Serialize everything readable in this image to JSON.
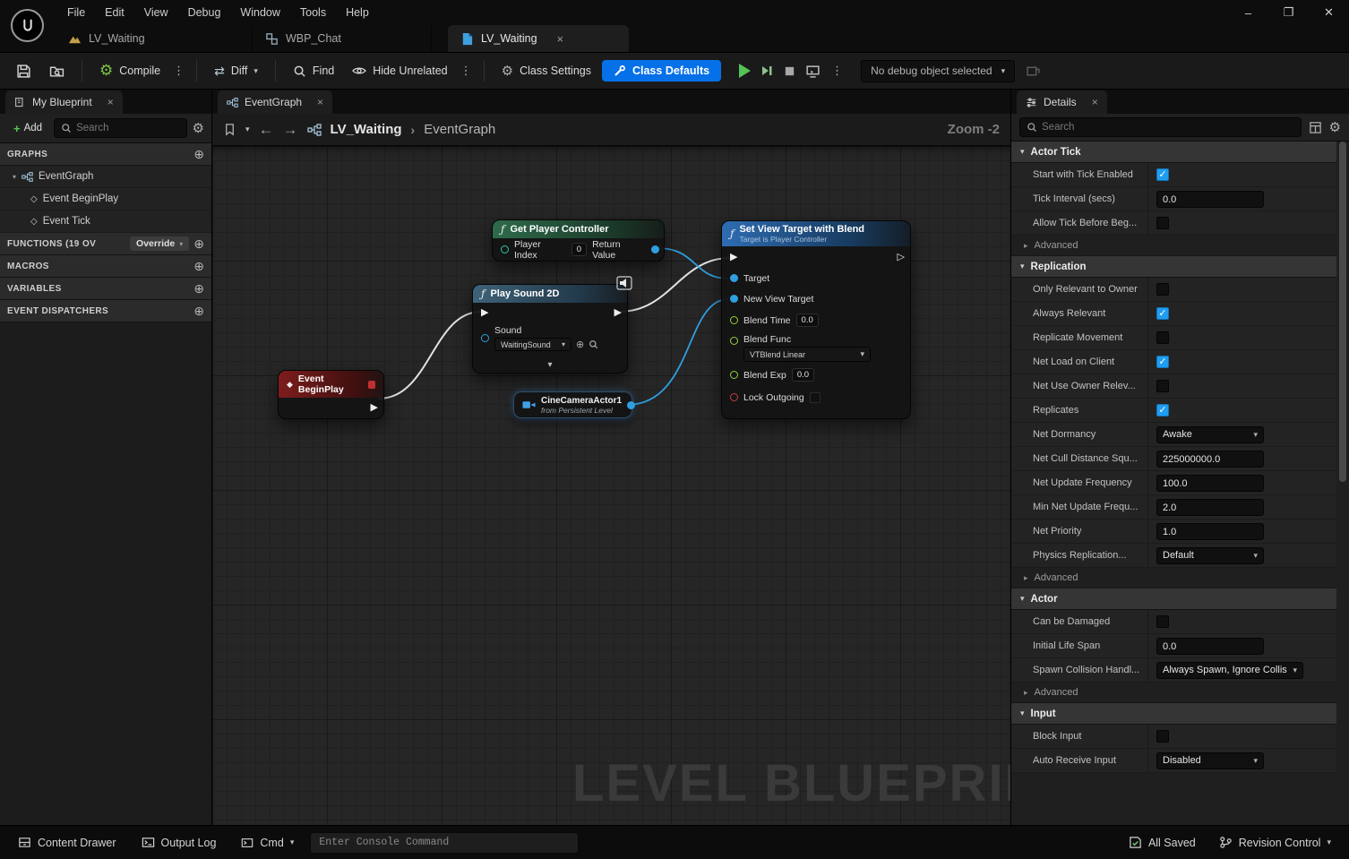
{
  "menubar": {
    "items": [
      "File",
      "Edit",
      "View",
      "Debug",
      "Window",
      "Tools",
      "Help"
    ]
  },
  "window_controls": {
    "minimize": "–",
    "maximize": "❐",
    "close": "✕"
  },
  "asset_tabs": {
    "tab1": "LV_Waiting",
    "tab2": "WBP_Chat",
    "tab3": "LV_Waiting",
    "close": "×"
  },
  "toolbar": {
    "compile": "Compile",
    "diff": "Diff",
    "find": "Find",
    "hide_unrelated": "Hide Unrelated",
    "class_settings": "Class Settings",
    "class_defaults": "Class Defaults",
    "debug_object": "No debug object selected"
  },
  "my_blueprint": {
    "title": "My Blueprint",
    "add": "Add",
    "search_placeholder": "Search",
    "graphs": "GRAPHS",
    "eventgraph": "EventGraph",
    "event_beginplay": "Event BeginPlay",
    "event_tick": "Event Tick",
    "functions": "FUNCTIONS (19 OV",
    "override": "Override",
    "macros": "MACROS",
    "variables": "VARIABLES",
    "event_dispatchers": "EVENT DISPATCHERS"
  },
  "graph": {
    "tab": "EventGraph",
    "breadcrumb_root": "LV_Waiting",
    "breadcrumb_current": "EventGraph",
    "zoom": "Zoom -2",
    "watermark": "LEVEL BLUEPRINT",
    "event_beginplay": {
      "title": "Event BeginPlay"
    },
    "get_player_controller": {
      "title": "Get Player Controller",
      "player_index": "Player Index",
      "player_index_value": "0",
      "return_value": "Return Value"
    },
    "play_sound": {
      "title": "Play Sound 2D",
      "sound": "Sound",
      "sound_value": "WaitingSound"
    },
    "camera": {
      "title": "CineCameraActor1",
      "subtitle": "from Persistent Level"
    },
    "set_view_target": {
      "title": "Set View Target with Blend",
      "subtitle": "Target is Player Controller",
      "target": "Target",
      "new_view_target": "New View Target",
      "blend_time": "Blend Time",
      "blend_time_value": "0.0",
      "blend_func": "Blend Func",
      "blend_func_value": "VTBlend Linear",
      "blend_exp": "Blend Exp",
      "blend_exp_value": "0.0",
      "lock_outgoing": "Lock Outgoing"
    }
  },
  "details": {
    "title": "Details",
    "search_placeholder": "Search",
    "sections": [
      {
        "name": "Actor Tick",
        "rows": [
          {
            "label": "Start with Tick Enabled",
            "type": "checkbox",
            "checked": true
          },
          {
            "label": "Tick Interval (secs)",
            "type": "text",
            "value": "0.0"
          },
          {
            "label": "Allow Tick Before Beg...",
            "type": "checkbox",
            "checked": false
          },
          {
            "label": "Advanced",
            "type": "advanced"
          }
        ]
      },
      {
        "name": "Replication",
        "rows": [
          {
            "label": "Only Relevant to Owner",
            "type": "checkbox",
            "checked": false
          },
          {
            "label": "Always Relevant",
            "type": "checkbox",
            "checked": true
          },
          {
            "label": "Replicate Movement",
            "type": "checkbox",
            "checked": false
          },
          {
            "label": "Net Load on Client",
            "type": "checkbox",
            "checked": true
          },
          {
            "label": "Net Use Owner Relev...",
            "type": "checkbox",
            "checked": false
          },
          {
            "label": "Replicates",
            "type": "checkbox",
            "checked": true
          },
          {
            "label": "Net Dormancy",
            "type": "dropdown",
            "value": "Awake"
          },
          {
            "label": "Net Cull Distance Squ...",
            "type": "text",
            "value": "225000000.0"
          },
          {
            "label": "Net Update Frequency",
            "type": "text",
            "value": "100.0"
          },
          {
            "label": "Min Net Update Frequ...",
            "type": "text",
            "value": "2.0"
          },
          {
            "label": "Net Priority",
            "type": "text",
            "value": "1.0"
          },
          {
            "label": "Physics Replication...",
            "type": "dropdown",
            "value": "Default"
          },
          {
            "label": "Advanced",
            "type": "advanced"
          }
        ]
      },
      {
        "name": "Actor",
        "rows": [
          {
            "label": "Can be Damaged",
            "type": "checkbox",
            "checked": false
          },
          {
            "label": "Initial Life Span",
            "type": "text",
            "value": "0.0"
          },
          {
            "label": "Spawn Collision Handl...",
            "type": "dropdown",
            "value": "Always Spawn, Ignore Collis",
            "wide": true
          },
          {
            "label": "Advanced",
            "type": "advanced"
          }
        ]
      },
      {
        "name": "Input",
        "rows": [
          {
            "label": "Block Input",
            "type": "checkbox",
            "checked": false
          },
          {
            "label": "Auto Receive Input",
            "type": "dropdown",
            "value": "Disabled"
          }
        ]
      }
    ]
  },
  "statusbar": {
    "content_drawer": "Content Drawer",
    "output_log": "Output Log",
    "cmd": "Cmd",
    "console_placeholder": "Enter Console Command",
    "all_saved": "All Saved",
    "revision_control": "Revision Control"
  }
}
